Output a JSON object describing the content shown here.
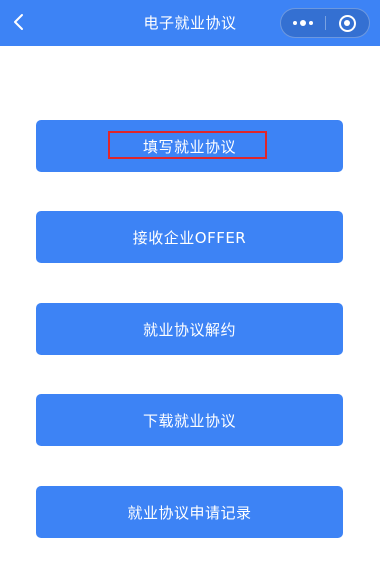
{
  "navbar": {
    "title": "电子就业协议",
    "back_icon": "chevron-left-icon",
    "more_icon": "more-dots-icon",
    "close_icon": "circle-target-icon",
    "background_color": "#3d83f5"
  },
  "buttons": [
    {
      "label": "填写就业协议",
      "highlighted": true
    },
    {
      "label": "接收企业OFFER",
      "highlighted": false
    },
    {
      "label": "就业协议解约",
      "highlighted": false
    },
    {
      "label": "下载就业协议",
      "highlighted": false
    },
    {
      "label": "就业协议申请记录",
      "highlighted": false
    }
  ],
  "colors": {
    "accent": "#3d83f5",
    "highlight": "#e0262b",
    "text_on_accent": "#ffffff"
  }
}
